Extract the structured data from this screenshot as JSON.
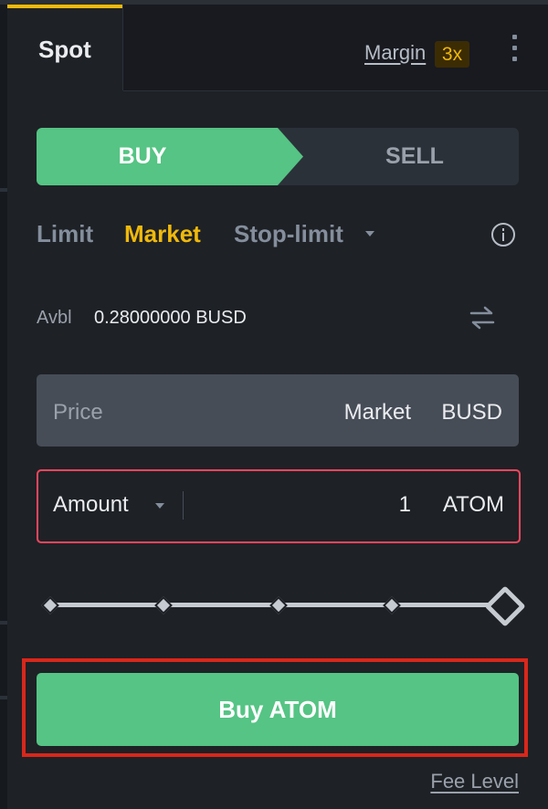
{
  "tabs": {
    "spot": "Spot",
    "margin": "Margin",
    "leverage": "3x"
  },
  "side_toggle": {
    "buy": "BUY",
    "sell": "SELL",
    "selected": "BUY"
  },
  "order_types": {
    "limit": "Limit",
    "market": "Market",
    "stop_limit": "Stop-limit",
    "selected": "Market"
  },
  "available": {
    "label": "Avbl",
    "value": "0.28000000 BUSD"
  },
  "price_field": {
    "placeholder": "Price",
    "value": "Market",
    "unit": "BUSD"
  },
  "amount_field": {
    "label": "Amount",
    "value": "1",
    "unit": "ATOM"
  },
  "slider": {
    "value_percent": 100
  },
  "submit": {
    "label": "Buy ATOM"
  },
  "fee_link": "Fee Level",
  "colors": {
    "accent": "#f0b90b",
    "buy": "#55c484",
    "error_border": "#f6465d",
    "highlight": "#d9271b"
  },
  "icons": [
    "more-vertical-icon",
    "info-icon",
    "swap-icon",
    "chevron-down-icon"
  ]
}
